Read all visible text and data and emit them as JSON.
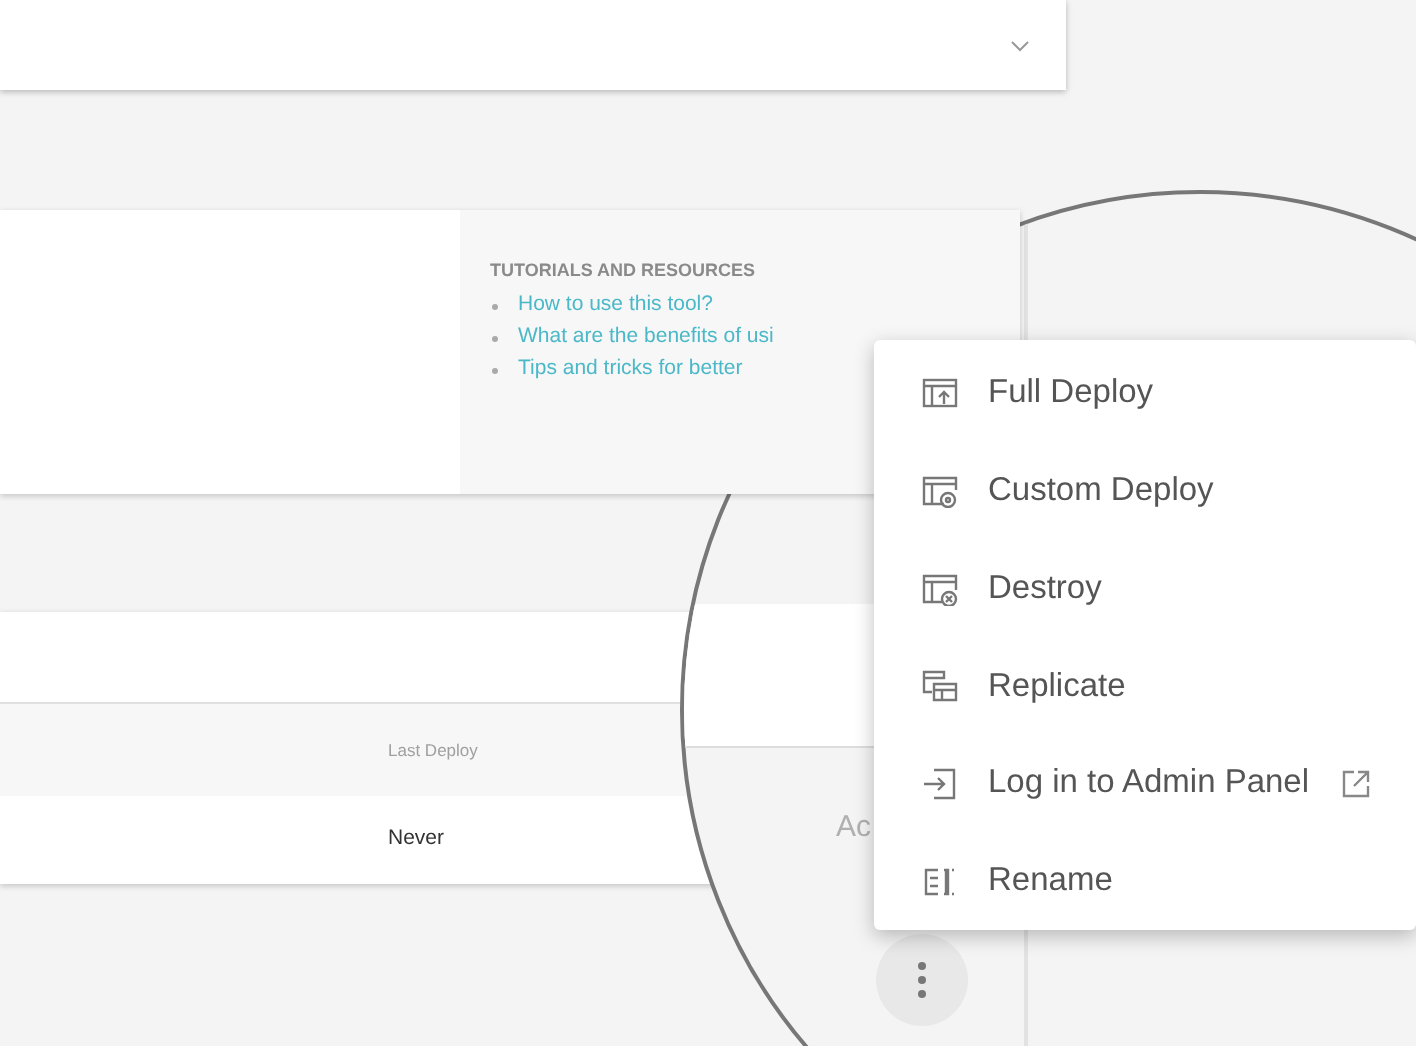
{
  "resources": {
    "heading": "TUTORIALS AND RESOURCES",
    "links": [
      "How to use this tool?",
      "What are the benefits of usi",
      "Tips and tricks for better"
    ]
  },
  "table": {
    "columns": [
      "Last Deploy"
    ],
    "rows": [
      [
        "Never"
      ]
    ]
  },
  "lens": {
    "column_label": "Ac"
  },
  "menu": {
    "items": [
      {
        "kind": "deploy",
        "label": "Full Deploy",
        "external": false
      },
      {
        "kind": "custom",
        "label": "Custom Deploy",
        "external": false
      },
      {
        "kind": "destroy",
        "label": "Destroy",
        "external": false
      },
      {
        "kind": "replicate",
        "label": "Replicate",
        "external": false
      },
      {
        "kind": "login",
        "label": "Log in to Admin Panel",
        "external": true
      },
      {
        "kind": "rename",
        "label": "Rename",
        "external": false
      }
    ]
  }
}
